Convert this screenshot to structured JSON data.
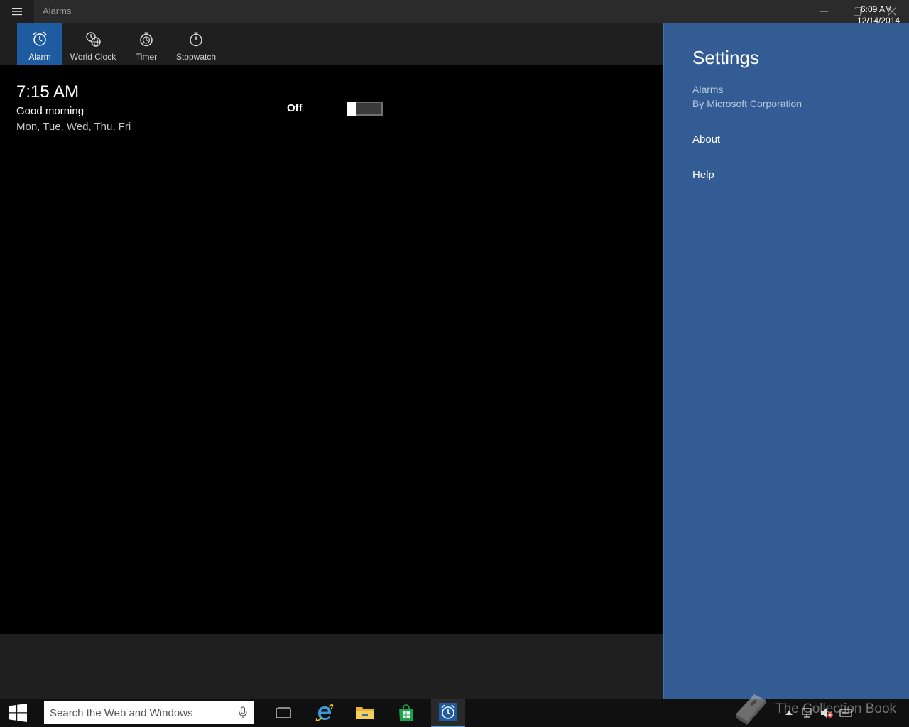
{
  "window": {
    "title": "Alarms",
    "icons": {
      "menu": "hamburger-icon",
      "minimize": "minimize-icon",
      "maximize": "restore-icon",
      "close": "close-icon"
    }
  },
  "tabs": [
    {
      "label": "Alarm",
      "icon": "alarm-clock-icon",
      "active": true
    },
    {
      "label": "World Clock",
      "icon": "world-clock-icon",
      "active": false
    },
    {
      "label": "Timer",
      "icon": "timer-icon",
      "active": false
    },
    {
      "label": "Stopwatch",
      "icon": "stopwatch-icon",
      "active": false
    }
  ],
  "alarm": {
    "time": "7:15 AM",
    "name": "Good morning",
    "days": "Mon, Tue, Wed, Thu, Fri",
    "toggle_label": "Off",
    "enabled": false
  },
  "settings": {
    "title": "Settings",
    "app_name": "Alarms",
    "publisher": "By Microsoft Corporation",
    "links": [
      "About",
      "Help"
    ]
  },
  "taskbar": {
    "search_placeholder": "Search the Web and Windows",
    "pinned": [
      "task-view-icon",
      "internet-explorer-icon",
      "file-explorer-icon",
      "store-icon",
      "alarms-app-icon"
    ],
    "clock_time": "6:09 AM",
    "clock_date": "12/14/2014",
    "watermark": "The Collection Book"
  },
  "colors": {
    "accent": "#1e5ba1",
    "settings_bg": "#335b94",
    "titlebar_bg": "#2b2b2b",
    "tabbar_bg": "#1f1f1f"
  }
}
